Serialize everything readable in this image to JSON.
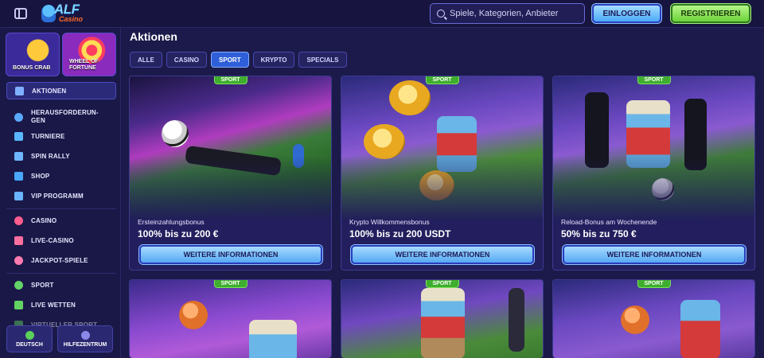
{
  "header": {
    "logo_text": "ALF",
    "logo_sub": "Casino",
    "search_placeholder": "Spiele, Kategorien, Anbieter",
    "login_label": "EINLOGGEN",
    "register_label": "REGISTRIEREN"
  },
  "sidebar": {
    "promos": [
      {
        "label": "BONUS CRAB"
      },
      {
        "label": "WHEEL OF FORTUNE"
      }
    ],
    "items": [
      {
        "label": "AKTIONEN",
        "icon": "gift-icon",
        "color": "#7fb0ff"
      },
      {
        "label": "HERAUSFORDERUN-GEN",
        "icon": "badge-icon",
        "color": "#5aa8ff"
      },
      {
        "label": "TURNIERE",
        "icon": "cup-icon",
        "color": "#58b7ff"
      },
      {
        "label": "SPIN RALLY",
        "icon": "flag-icon",
        "color": "#6db6ff"
      },
      {
        "label": "SHOP",
        "icon": "bag-icon",
        "color": "#4aa8ff"
      },
      {
        "label": "VIP PROGRAMM",
        "icon": "crown-icon",
        "color": "#69b4ff"
      },
      {
        "label": "CASINO",
        "icon": "cherry-icon",
        "color": "#ff5d8f"
      },
      {
        "label": "LIVE-CASINO",
        "icon": "dealer-icon",
        "color": "#ff6fa0"
      },
      {
        "label": "JACKPOT-SPIELE",
        "icon": "clover-icon",
        "color": "#ff7ab0"
      },
      {
        "label": "SPORT",
        "icon": "football-icon",
        "color": "#63d36a"
      },
      {
        "label": "LIVE WETTEN",
        "icon": "live-icon",
        "color": "#62d262"
      },
      {
        "label": "VIRTUELLER SPORT",
        "icon": "virtual-icon",
        "color": "#5ccc5c"
      }
    ],
    "language_label": "DEUTSCH",
    "help_label": "HILFEZENTRUM"
  },
  "main": {
    "title": "Aktionen",
    "filters": [
      "ALLE",
      "CASINO",
      "SPORT",
      "KRYPTO",
      "SPECIALS"
    ],
    "active_filter": "SPORT",
    "cards": [
      {
        "tag": "SPORT",
        "subtitle": "Ersteinzahlungsbonus",
        "offer": "100% bis zu 200 €",
        "button": "WEITERE INFORMATIONEN"
      },
      {
        "tag": "SPORT",
        "subtitle": "Krypto Willkommensbonus",
        "offer": "100% bis zu 200 USDT",
        "button": "WEITERE INFORMATIONEN"
      },
      {
        "tag": "SPORT",
        "subtitle": "Reload-Bonus am Wochenende",
        "offer": "50% bis zu 750 €",
        "button": "WEITERE INFORMATIONEN"
      },
      {
        "tag": "SPORT"
      },
      {
        "tag": "SPORT"
      },
      {
        "tag": "SPORT"
      }
    ]
  },
  "colors": {
    "background": "#1c1a4a",
    "accent_blue": "#56a8f3",
    "accent_green": "#6cd23a",
    "sport_tag": "#3fae2e"
  }
}
